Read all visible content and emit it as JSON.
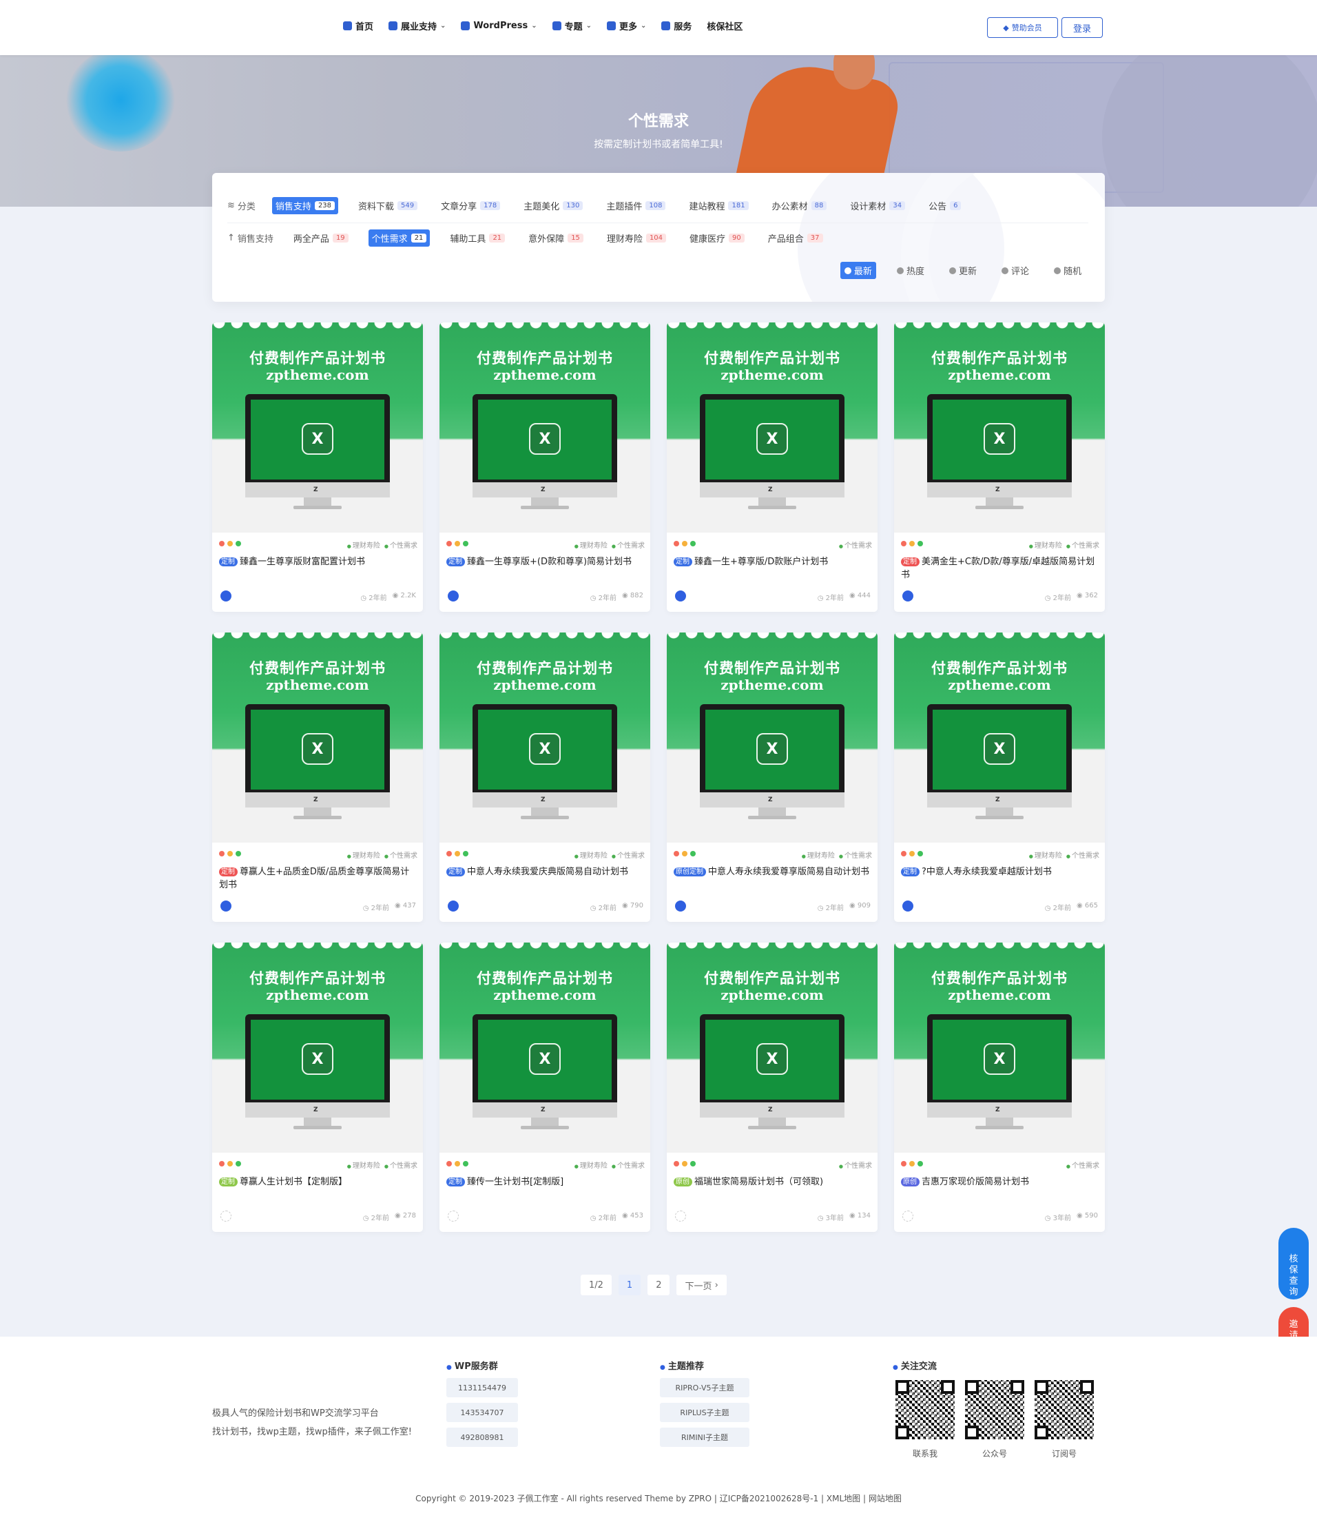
{
  "nav": {
    "items": [
      {
        "label": "首页",
        "dropdown": false,
        "icon": "home-icon"
      },
      {
        "label": "展业支持",
        "dropdown": true,
        "icon": "support-icon"
      },
      {
        "label": "WordPress",
        "dropdown": true,
        "icon": "wordpress-icon"
      },
      {
        "label": "专题",
        "dropdown": true,
        "icon": "topic-icon"
      },
      {
        "label": "更多",
        "dropdown": true,
        "icon": "more-icon"
      },
      {
        "label": "服务",
        "dropdown": false,
        "icon": "service-icon"
      },
      {
        "label": "核保社区",
        "dropdown": false,
        "icon": ""
      }
    ],
    "vip_label": "赞助会员",
    "login_label": "登录"
  },
  "hero": {
    "title": "个性需求",
    "subtitle": "按需定制计划书或者简单工具!"
  },
  "filters": {
    "row1_label": "分类",
    "row1": [
      {
        "label": "销售支持",
        "count": "238",
        "active": true,
        "color": "blue"
      },
      {
        "label": "资料下载",
        "count": "549",
        "active": false,
        "color": "blue"
      },
      {
        "label": "文章分享",
        "count": "178",
        "active": false,
        "color": "blue"
      },
      {
        "label": "主题美化",
        "count": "130",
        "active": false,
        "color": "blue"
      },
      {
        "label": "主题插件",
        "count": "108",
        "active": false,
        "color": "blue"
      },
      {
        "label": "建站教程",
        "count": "181",
        "active": false,
        "color": "blue"
      },
      {
        "label": "办公素材",
        "count": "88",
        "active": false,
        "color": "blue"
      },
      {
        "label": "设计素材",
        "count": "34",
        "active": false,
        "color": "blue"
      },
      {
        "label": "公告",
        "count": "6",
        "active": false,
        "color": "blue"
      }
    ],
    "row2_label": "销售支持",
    "row2": [
      {
        "label": "两全产品",
        "count": "19",
        "active": false,
        "color": "red"
      },
      {
        "label": "个性需求",
        "count": "21",
        "active": true,
        "color": "red"
      },
      {
        "label": "辅助工具",
        "count": "21",
        "active": false,
        "color": "red"
      },
      {
        "label": "意外保障",
        "count": "15",
        "active": false,
        "color": "red"
      },
      {
        "label": "理财寿险",
        "count": "104",
        "active": false,
        "color": "red"
      },
      {
        "label": "健康医疗",
        "count": "90",
        "active": false,
        "color": "red"
      },
      {
        "label": "产品组合",
        "count": "37",
        "active": false,
        "color": "red"
      }
    ],
    "sort": [
      {
        "label": "最新",
        "active": true
      },
      {
        "label": "热度",
        "active": false
      },
      {
        "label": "更新",
        "active": false
      },
      {
        "label": "评论",
        "active": false
      },
      {
        "label": "随机",
        "active": false
      }
    ]
  },
  "thumb": {
    "title": "付费制作产品计划书",
    "site": "zptheme.com",
    "excel_letter": "X",
    "brand_letter": "Z"
  },
  "cards": [
    {
      "cats": [
        "理财寿险",
        "个性需求"
      ],
      "badge": "定制",
      "badge_color": "blue",
      "title": "臻鑫一生尊享版财富配置计划书",
      "time": "2年前",
      "views": "2.2K",
      "avatar": true
    },
    {
      "cats": [
        "理财寿险",
        "个性需求"
      ],
      "badge": "定制",
      "badge_color": "blue",
      "title": "臻鑫一生尊享版+(D款和尊享)简易计划书",
      "time": "2年前",
      "views": "882",
      "avatar": true
    },
    {
      "cats": [
        "个性需求"
      ],
      "badge": "定制",
      "badge_color": "blue",
      "title": "臻鑫一生+尊享版/D款账户计划书",
      "time": "2年前",
      "views": "444",
      "avatar": true
    },
    {
      "cats": [
        "理财寿险",
        "个性需求"
      ],
      "badge": "定制",
      "badge_color": "red",
      "title": "美满金生+C款/D款/尊享版/卓越版简易计划书",
      "time": "2年前",
      "views": "362",
      "avatar": true
    },
    {
      "cats": [
        "理财寿险",
        "个性需求"
      ],
      "badge": "定制",
      "badge_color": "red",
      "title": "尊赢人生+品质金D版/品质金尊享版简易计划书",
      "time": "2年前",
      "views": "437",
      "avatar": true
    },
    {
      "cats": [
        "理财寿险",
        "个性需求"
      ],
      "badge": "定制",
      "badge_color": "blue",
      "title": "中意人寿永续我爱庆典版简易自动计划书",
      "time": "2年前",
      "views": "790",
      "avatar": true
    },
    {
      "cats": [
        "理财寿险",
        "个性需求"
      ],
      "badge": "原创定制",
      "badge_color": "blue",
      "title": "中意人寿永续我爱尊享版简易自动计划书",
      "time": "2年前",
      "views": "909",
      "avatar": true
    },
    {
      "cats": [
        "理财寿险",
        "个性需求"
      ],
      "badge": "定制",
      "badge_color": "blue",
      "title": "?中意人寿永续我爱卓越版计划书",
      "time": "2年前",
      "views": "665",
      "avatar": true
    },
    {
      "cats": [
        "理财寿险",
        "个性需求"
      ],
      "badge": "定制",
      "badge_color": "green",
      "title": "尊赢人生计划书【定制版】",
      "time": "2年前",
      "views": "278",
      "avatar": false
    },
    {
      "cats": [
        "理财寿险",
        "个性需求"
      ],
      "badge": "定制",
      "badge_color": "blue",
      "title": "臻传一生计划书[定制版]",
      "time": "2年前",
      "views": "453",
      "avatar": false
    },
    {
      "cats": [
        "个性需求"
      ],
      "badge": "原创",
      "badge_color": "green",
      "title": "福瑞世家简易版计划书（可领取)",
      "time": "3年前",
      "views": "134",
      "avatar": false
    },
    {
      "cats": [
        "个性需求"
      ],
      "badge": "原创",
      "badge_color": "purple",
      "title": "吉惠万家现价版简易计划书",
      "time": "3年前",
      "views": "590",
      "avatar": false
    }
  ],
  "pagination": {
    "info": "1/2",
    "current": "1",
    "next_page": "2",
    "next_label": "下一页"
  },
  "floating": {
    "query_label": "核保查询",
    "invite_label": "邀请有礼"
  },
  "footer": {
    "desc1": "极具人气的保险计划书和WP交流学习平台",
    "desc2": "找计划书，找wp主题，找wp插件，来子佩工作室!",
    "wp_group_title": "WP服务群",
    "wp_groups": [
      "1131154479",
      "143534707",
      "492808981"
    ],
    "theme_title": "主题推荐",
    "themes": [
      "RIPRO-V5子主题",
      "RIPLUS子主题",
      "RIMINI子主题"
    ],
    "follow_title": "关注交流",
    "qr_labels": [
      "联系我",
      "公众号",
      "订阅号"
    ],
    "copyright": "Copyright © 2019-2023  子佩工作室  - All rights reserved Theme by  ZPRO  |  辽ICP备2021002628号-1  |  XML地图  |  网站地图"
  }
}
